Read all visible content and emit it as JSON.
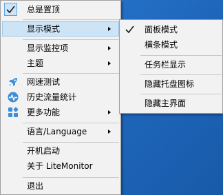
{
  "main_menu": {
    "always_on_top": "总是置顶",
    "display_mode": "显示模式",
    "display_items": "显示监控项",
    "theme": "主题",
    "speed_test": "网速测试",
    "traffic_stats": "历史流量统计",
    "more_features": "更多功能",
    "language": "语言/Language",
    "autostart": "开机启动",
    "about": "关于 LiteMonitor",
    "exit": "退出"
  },
  "sub_menu": {
    "panel_mode": "面板模式",
    "bar_mode": "横条模式",
    "taskbar_display": "任务栏显示",
    "hide_tray_icon": "隐藏托盘图标",
    "hide_main_window": "隐藏主界面"
  },
  "state": {
    "always_on_top_checked": true,
    "panel_mode_checked": true
  },
  "colors": {
    "accent": "#3c8fd8",
    "highlight_bg": "#cde4f7",
    "highlight_border": "#99c9ef",
    "menu_bg": "#f2f2f2",
    "desktop_bg": "#1f69bf"
  },
  "icons": [
    "check-icon",
    "rocket-icon",
    "pulse-icon",
    "apps-grid-icon",
    "submenu-arrow-icon"
  ]
}
